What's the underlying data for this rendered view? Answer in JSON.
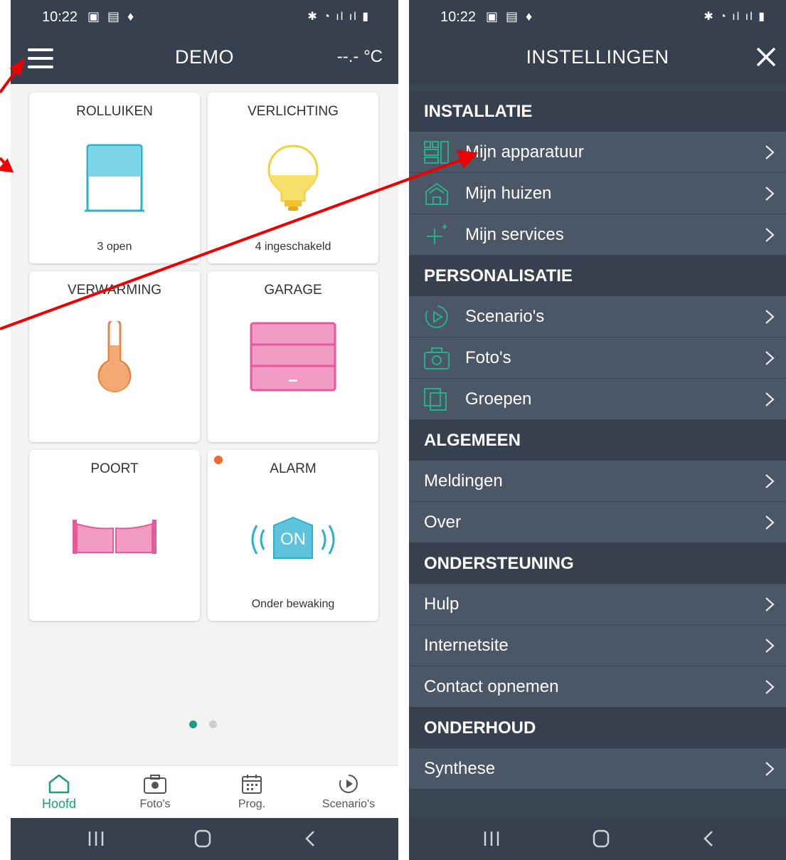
{
  "status": {
    "time_left": "10:22",
    "time_right": "10:22",
    "icons_left": "▣ ▤ ♦",
    "icons_right": "✱ ◔ ıl ıl ▮"
  },
  "left": {
    "title": "DEMO",
    "temperature": "--.- °C",
    "tiles": [
      {
        "title": "ROLLUIKEN",
        "status": "3 open"
      },
      {
        "title": "VERLICHTING",
        "status": "4 ingeschakeld"
      },
      {
        "title": "VERWARMING",
        "status": ""
      },
      {
        "title": "GARAGE",
        "status": ""
      },
      {
        "title": "POORT",
        "status": ""
      },
      {
        "title": "ALARM",
        "status": "Onder bewaking",
        "badge": "ON"
      }
    ],
    "pager": {
      "pages": 2,
      "current": 1
    },
    "nav": [
      {
        "label": "Hoofd",
        "icon": "home-icon"
      },
      {
        "label": "Foto's",
        "icon": "camera-icon"
      },
      {
        "label": "Prog.",
        "icon": "calendar-icon"
      },
      {
        "label": "Scenario's",
        "icon": "play-icon"
      }
    ]
  },
  "right": {
    "title": "INSTELLINGEN",
    "sections": [
      {
        "header": "INSTALLATIE",
        "items": [
          {
            "label": "Mijn apparatuur",
            "icon": "devices-icon"
          },
          {
            "label": "Mijn huizen",
            "icon": "house-icon"
          },
          {
            "label": "Mijn services",
            "icon": "plus-icon"
          }
        ]
      },
      {
        "header": "PERSONALISATIE",
        "items": [
          {
            "label": "Scenario's",
            "icon": "play-icon"
          },
          {
            "label": "Foto's",
            "icon": "camera-icon"
          },
          {
            "label": "Groepen",
            "icon": "groups-icon"
          }
        ]
      },
      {
        "header": "ALGEMEEN",
        "items": [
          {
            "label": "Meldingen"
          },
          {
            "label": "Over"
          }
        ]
      },
      {
        "header": "ONDERSTEUNING",
        "items": [
          {
            "label": "Hulp"
          },
          {
            "label": "Internetsite"
          },
          {
            "label": "Contact opnemen"
          }
        ]
      },
      {
        "header": "ONDERHOUD",
        "items": [
          {
            "label": "Synthese"
          }
        ]
      }
    ]
  },
  "colors": {
    "bar": "#36404f",
    "row": "#4b5666",
    "accent": "#1f9c7e",
    "arrow": "#ee0000",
    "pink": "#ec68a6",
    "cyan": "#5dc4dc"
  }
}
